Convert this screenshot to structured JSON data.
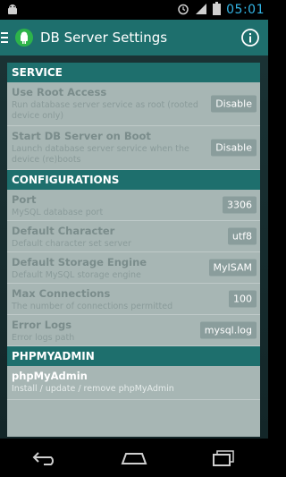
{
  "status_bar": {
    "time": "05:01",
    "icons": [
      "android-notification-icon",
      "alarm-icon",
      "signal-icon",
      "battery-icon"
    ]
  },
  "action_bar": {
    "title": "DB Server Settings",
    "info_icon": "info-icon"
  },
  "sections": [
    {
      "header": "SERVICE",
      "rows": [
        {
          "title": "Use Root Access",
          "subtitle": "Run database server service as root (rooted device only)",
          "value": "Disable",
          "active": false
        },
        {
          "title": "Start DB Server on Boot",
          "subtitle": "Launch database server service when the device (re)boots",
          "value": "Disable",
          "active": false
        }
      ]
    },
    {
      "header": "CONFIGURATIONS",
      "rows": [
        {
          "title": "Port",
          "subtitle": "MySQL database port",
          "value": "3306",
          "active": false
        },
        {
          "title": "Default Character",
          "subtitle": "Default character set server",
          "value": "utf8",
          "active": false
        },
        {
          "title": "Default Storage Engine",
          "subtitle": "Default MySQL storage engine",
          "value": "MyISAM",
          "active": false
        },
        {
          "title": "Max Connections",
          "subtitle": "The number of connections permitted",
          "value": "100",
          "active": false
        },
        {
          "title": "Error Logs",
          "subtitle": "Error logs path",
          "value": "mysql.log",
          "active": false
        }
      ]
    },
    {
      "header": "PHPMYADMIN",
      "rows": [
        {
          "title": "phpMyAdmin",
          "subtitle": "Install / update / remove phpMyAdmin",
          "value": "",
          "active": true
        }
      ]
    }
  ],
  "colors": {
    "accent": "#1e6f6d",
    "clock": "#33b5e5"
  }
}
